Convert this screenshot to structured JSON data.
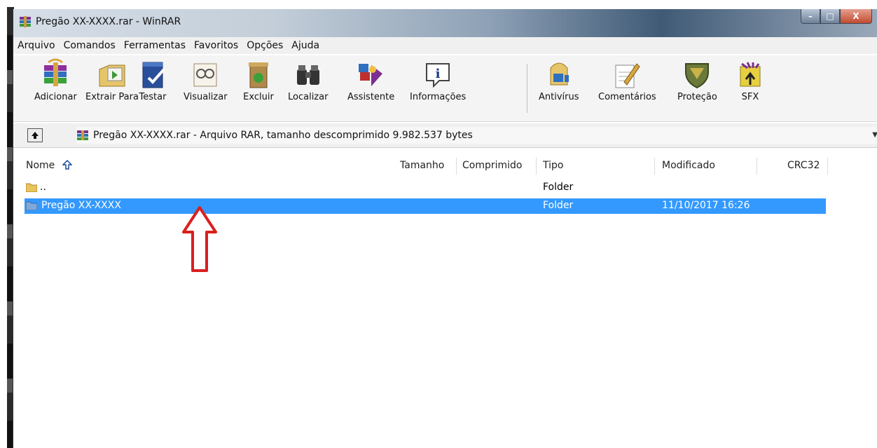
{
  "window": {
    "title": "Pregão XX-XXXX.rar - WinRAR",
    "controls": {
      "minimize": "–",
      "maximize": "□",
      "close": "X"
    }
  },
  "menubar": {
    "items": [
      "Arquivo",
      "Comandos",
      "Ferramentas",
      "Favoritos",
      "Opções",
      "Ajuda"
    ]
  },
  "toolbar": {
    "buttons": [
      {
        "label": "Adicionar",
        "icon": "add-archive-icon"
      },
      {
        "label": "Extrair Para",
        "icon": "extract-to-icon"
      },
      {
        "label": "Testar",
        "icon": "test-icon"
      },
      {
        "label": "Visualizar",
        "icon": "view-icon"
      },
      {
        "label": "Excluir",
        "icon": "delete-icon"
      },
      {
        "label": "Localizar",
        "icon": "find-icon"
      },
      {
        "label": "Assistente",
        "icon": "wizard-icon"
      },
      {
        "label": "Informações",
        "icon": "info-icon"
      },
      {
        "label": "Antivírus",
        "icon": "antivirus-icon"
      },
      {
        "label": "Comentários",
        "icon": "comment-icon"
      },
      {
        "label": "Proteção",
        "icon": "protect-icon"
      },
      {
        "label": "SFX",
        "icon": "sfx-icon"
      }
    ]
  },
  "address": {
    "text": "Pregão XX-XXXX.rar - Arquivo RAR, tamanho descomprimido 9.982.537 bytes"
  },
  "columns": {
    "name": "Nome",
    "size": "Tamanho",
    "packed": "Comprimido",
    "type": "Tipo",
    "modified": "Modificado",
    "crc": "CRC32"
  },
  "files": [
    {
      "name": "..",
      "type": "Folder",
      "modified": "",
      "selected": false
    },
    {
      "name": "Pregão XX-XXXX",
      "type": "Folder",
      "modified": "11/10/2017 16:26",
      "selected": true
    }
  ],
  "colors": {
    "selection": "#3399ff",
    "annotation_arrow": "#d92020"
  }
}
